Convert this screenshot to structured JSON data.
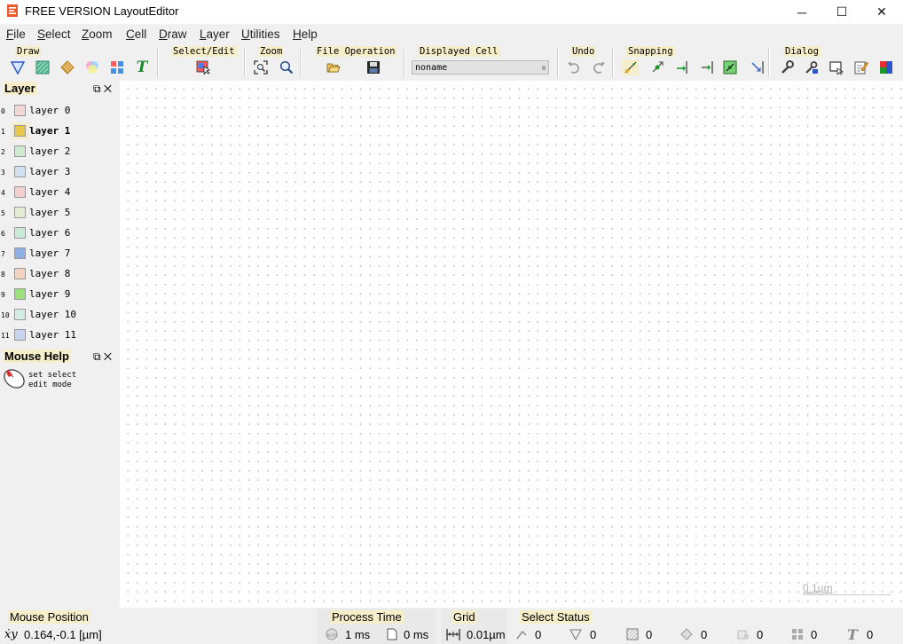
{
  "window": {
    "title": "FREE VERSION LayoutEditor",
    "minimize": "─",
    "maximize": "☐",
    "close": "✕"
  },
  "menu": [
    "File",
    "Select",
    "Zoom",
    "Cell",
    "Draw",
    "Layer",
    "Utilities",
    "Help"
  ],
  "toolbar": {
    "groups": [
      "Draw",
      "Select/Edit",
      "Zoom",
      "File Operation",
      "Displayed Cell",
      "Undo",
      "Snapping",
      "Dialog"
    ],
    "displayed_cell": "noname"
  },
  "layer_panel": {
    "title": "Layer",
    "layers": [
      {
        "key": "0",
        "name": "layer 0",
        "color": "#f2d7d5"
      },
      {
        "key": "1",
        "name": "layer 1",
        "color": "#e6c84a"
      },
      {
        "key": "2",
        "name": "layer 2",
        "color": "#cfe9cf"
      },
      {
        "key": "3",
        "name": "layer 3",
        "color": "#cfe0ef"
      },
      {
        "key": "4",
        "name": "layer 4",
        "color": "#f3cfcf"
      },
      {
        "key": "5",
        "name": "layer 5",
        "color": "#e3ecd2"
      },
      {
        "key": "6",
        "name": "layer 6",
        "color": "#c9ecd9"
      },
      {
        "key": "7",
        "name": "layer 7",
        "color": "#8fb0e6"
      },
      {
        "key": "8",
        "name": "layer 8",
        "color": "#f3d3bf"
      },
      {
        "key": "9",
        "name": "layer 9",
        "color": "#9be07a"
      },
      {
        "key": "10",
        "name": "layer 10",
        "color": "#d3ebe3"
      },
      {
        "key": "11",
        "name": "layer 11",
        "color": "#c7d3ef"
      }
    ],
    "active": "layer 1"
  },
  "mouse_help": {
    "title": "Mouse Help",
    "text": "set select edit mode"
  },
  "canvas": {
    "scale_label": "0.1µm"
  },
  "status": {
    "mouse_position_label": "Mouse Position",
    "mouse_position_value": "0.164,-0.1 [µm]",
    "process_time_label": "Process Time",
    "process_time_value1": "1 ms",
    "process_time_value2": "0 ms",
    "grid_label": "Grid",
    "grid_value": "0.01µm",
    "select_status_label": "Select Status",
    "select_counts": [
      "0",
      "0",
      "0",
      "0",
      "0",
      "0",
      "0"
    ]
  }
}
